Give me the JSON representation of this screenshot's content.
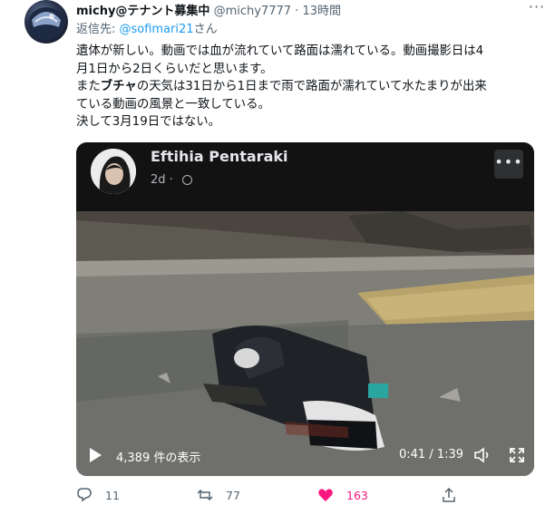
{
  "tweet": {
    "display_name": "michy@テナント募集中",
    "handle": "@michy7777",
    "separator": "·",
    "time": "13時間",
    "reply_prefix": "返信先: ",
    "reply_handle": "@sofimari21",
    "reply_suffix": "さん",
    "text": {
      "line1": "遺体が新しい。動画では血が流れていて路面は濡れている。動画撮影日は4",
      "line2": "月1日から2日くらいだと思います。",
      "line3_before": "また",
      "line3_bold": "ブチャ",
      "line3_after": "の天気は31日から1日まで雨で路面が濡れていて水たまりが出来",
      "line4": "ている動画の風景と一致している。",
      "line5": "決して3月19日ではない。"
    }
  },
  "embedded_post": {
    "author": "Eftihia Pentaraki",
    "age": "2d",
    "more_label": "•••"
  },
  "video": {
    "views": "4,389 件の表示",
    "timecode": "0:41 / 1:39",
    "progress_fraction": 0.413
  },
  "actions": {
    "reply_count": "11",
    "retweet_count": "77",
    "like_count": "163",
    "more_label": "···"
  },
  "colors": {
    "accent_blue": "#1d9bf0",
    "like_pink": "#f91880",
    "muted": "#536471"
  }
}
